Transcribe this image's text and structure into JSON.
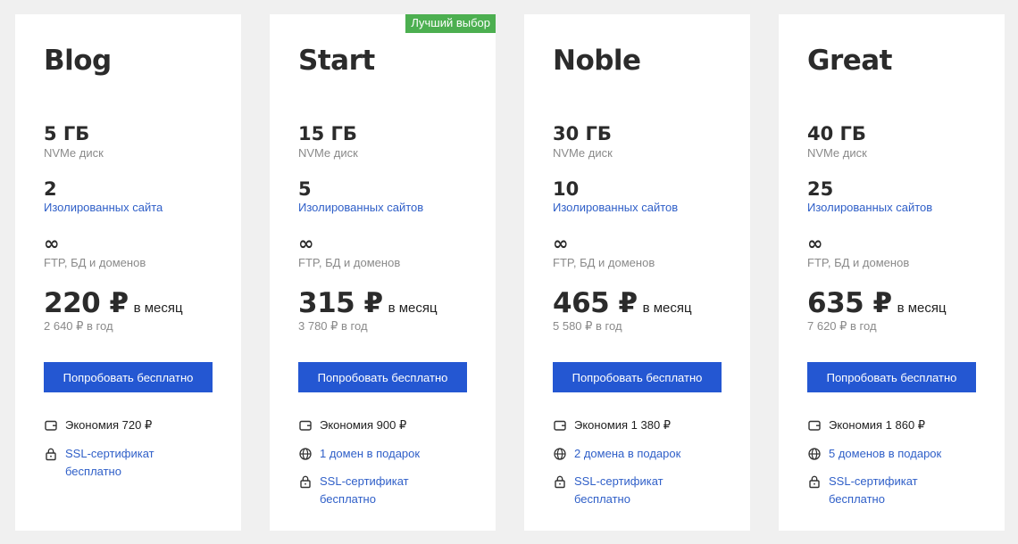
{
  "plans": [
    {
      "name": "Blog",
      "disk": "5 ГБ",
      "disk_label": "NVMe диск",
      "sites": "2",
      "sites_label": "Изолированных сайта",
      "ftp": "∞",
      "ftp_label": "FTP, БД и доменов",
      "price": "220 ₽",
      "period": "в месяц",
      "year_price": "2 640 ₽ в год",
      "button": "Попробовать бесплатно",
      "saving": "Экономия 720 ₽",
      "ssl": "SSL-сертификат бесплатно"
    },
    {
      "name": "Start",
      "badge": "Лучший выбор",
      "disk": "15 ГБ",
      "disk_label": "NVMe диск",
      "sites": "5",
      "sites_label": "Изолированных сайтов",
      "ftp": "∞",
      "ftp_label": "FTP, БД и доменов",
      "price": "315 ₽",
      "period": "в месяц",
      "year_price": "3 780 ₽ в год",
      "button": "Попробовать бесплатно",
      "saving": "Экономия 900 ₽",
      "domains": "1 домен в подарок",
      "ssl": "SSL-сертификат бесплатно"
    },
    {
      "name": "Noble",
      "disk": "30 ГБ",
      "disk_label": "NVMe диск",
      "sites": "10",
      "sites_label": "Изолированных сайтов",
      "ftp": "∞",
      "ftp_label": "FTP, БД и доменов",
      "price": "465 ₽",
      "period": "в месяц",
      "year_price": "5 580 ₽ в год",
      "button": "Попробовать бесплатно",
      "saving": "Экономия 1 380 ₽",
      "domains": "2 домена в подарок",
      "ssl": "SSL-сертификат бесплатно"
    },
    {
      "name": "Great",
      "disk": "40 ГБ",
      "disk_label": "NVMe диск",
      "sites": "25",
      "sites_label": "Изолированных сайтов",
      "ftp": "∞",
      "ftp_label": "FTP, БД и доменов",
      "price": "635 ₽",
      "period": "в месяц",
      "year_price": "7 620 ₽ в год",
      "button": "Попробовать бесплатно",
      "saving": "Экономия 1 860 ₽",
      "domains": "5 доменов в подарок",
      "ssl": "SSL-сертификат бесплатно"
    }
  ],
  "icons": {
    "saving": "wallet-icon",
    "domains": "globe-icon",
    "ssl": "lock-icon"
  },
  "colors": {
    "accent": "#2457d2",
    "link": "#2f5fc8",
    "badge": "#4caf50"
  }
}
